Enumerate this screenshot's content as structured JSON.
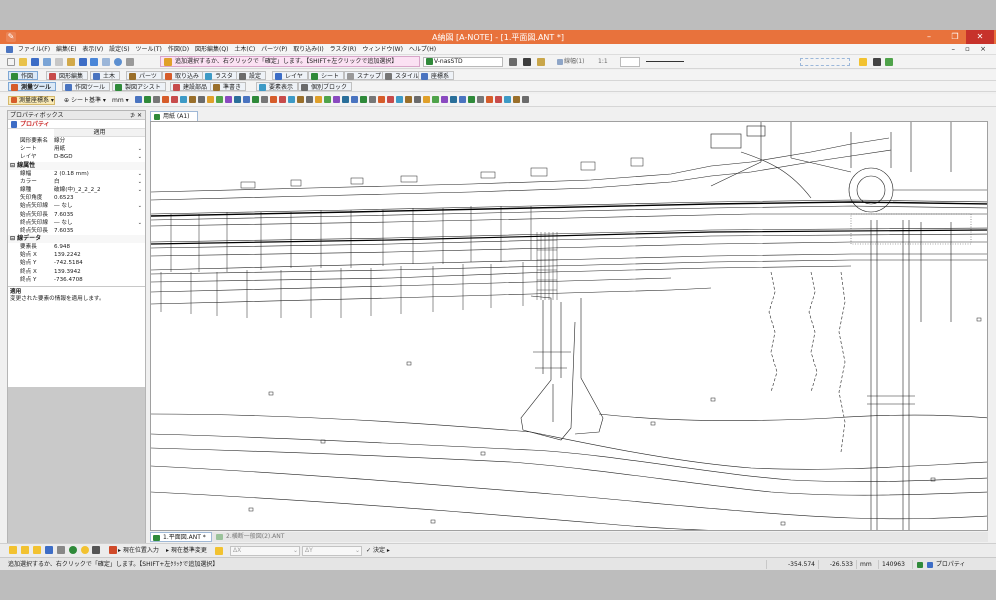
{
  "window": {
    "title": "A納図 [A-NOTE] - [1.平面図.ANT *]",
    "minimize": "–",
    "restore": "❐",
    "close": "✕"
  },
  "menu": {
    "items": [
      "ファイル(F)",
      "編集(E)",
      "表示(V)",
      "設定(S)",
      "ツール(T)",
      "作図(D)",
      "図形編集(Q)",
      "土木(C)",
      "パーツ(P)",
      "取り込み(I)",
      "ラスタ(R)",
      "ウィンドウ(W)",
      "ヘルプ(H)"
    ],
    "sys_buttons": "– ▫ ×"
  },
  "toolbar": {
    "message": "追加選択するか、右クリックで「確定」します。【SHIFT+左クリックで追加選択】",
    "style_combo": "V-nasSTD",
    "linewidth_label": "線幅(1)",
    "scale_label": "1:1"
  },
  "ribbon_row1": [
    "作図",
    "図形編集",
    "土木",
    "パーツ",
    "取り込み",
    "ラスタ",
    "設定",
    "レイヤ",
    "シート",
    "スナップ",
    "スタイル",
    "座標系"
  ],
  "ribbon_row2": [
    "測量ツール",
    "作図ツール",
    "製図アシスト",
    "建設部品",
    "準書き",
    "要素表示",
    "個別ブロック"
  ],
  "tool_row": {
    "coord": "測量座標系",
    "sheet": "シート基準",
    "unit": "mm"
  },
  "panel": {
    "title": "プロパティボックス",
    "pin": "⊅ ✕",
    "header": "プロパティ",
    "apply_col": "適用",
    "basic": [
      {
        "k": "図形要素名",
        "v": "線分"
      },
      {
        "k": "シート",
        "v": "用紙",
        "dd": true
      },
      {
        "k": "レイヤ",
        "v": "D-BGD",
        "dd": true
      }
    ],
    "sec_line": "線属性",
    "line_attrs": [
      {
        "k": "線幅",
        "v": "2 (0.18 mm)",
        "dd": true
      },
      {
        "k": "カラー",
        "v": "白",
        "dd": true
      },
      {
        "k": "線種",
        "v": "破線(中)_2_2_2_2",
        "dd": true
      },
      {
        "k": "矢印角度",
        "v": "0.6523",
        "dd": false
      },
      {
        "k": "始点矢印線",
        "v": "― なし",
        "dd": true
      },
      {
        "k": "始点矢印長",
        "v": "7.6035",
        "dd": false
      },
      {
        "k": "終点矢印線",
        "v": "― なし",
        "dd": true
      },
      {
        "k": "終点矢印長",
        "v": "7.6035",
        "dd": false
      }
    ],
    "sec_data": "線データ",
    "line_data": [
      {
        "k": "要素長",
        "v": "6.948"
      },
      {
        "k": "始点 X",
        "v": "139.2242"
      },
      {
        "k": "始点 Y",
        "v": "-742.5184"
      },
      {
        "k": "終点 X",
        "v": "139.3942"
      },
      {
        "k": "終点 Y",
        "v": "-736.4708"
      }
    ],
    "desc_title": "適用",
    "desc_text": "変更された要素の情報を適用します。"
  },
  "doc_tab": "用紙 (A1)",
  "bottom_tabs": [
    "1.平面図.ANT *",
    "2.横断一般図(2).ANT"
  ],
  "input_bar": {
    "current_pos": "現在位置入力",
    "base_change": "現在基準変更",
    "x_label": "ΔX",
    "y_label": "ΔY",
    "confirm": "決定"
  },
  "status": {
    "message": "追加選択するか、右クリックで「確定」します。【SHIFT+左ｸﾘｯｸで追加選択】",
    "x": "-354.574",
    "y": "-26.533",
    "unit": "mm",
    "count": "140963",
    "prop": "プロパティ"
  },
  "colors": {
    "title": "#e8723c",
    "close": "#c7322b",
    "message_bg": "#fbe1f3",
    "accent": "#3d6dc6"
  }
}
